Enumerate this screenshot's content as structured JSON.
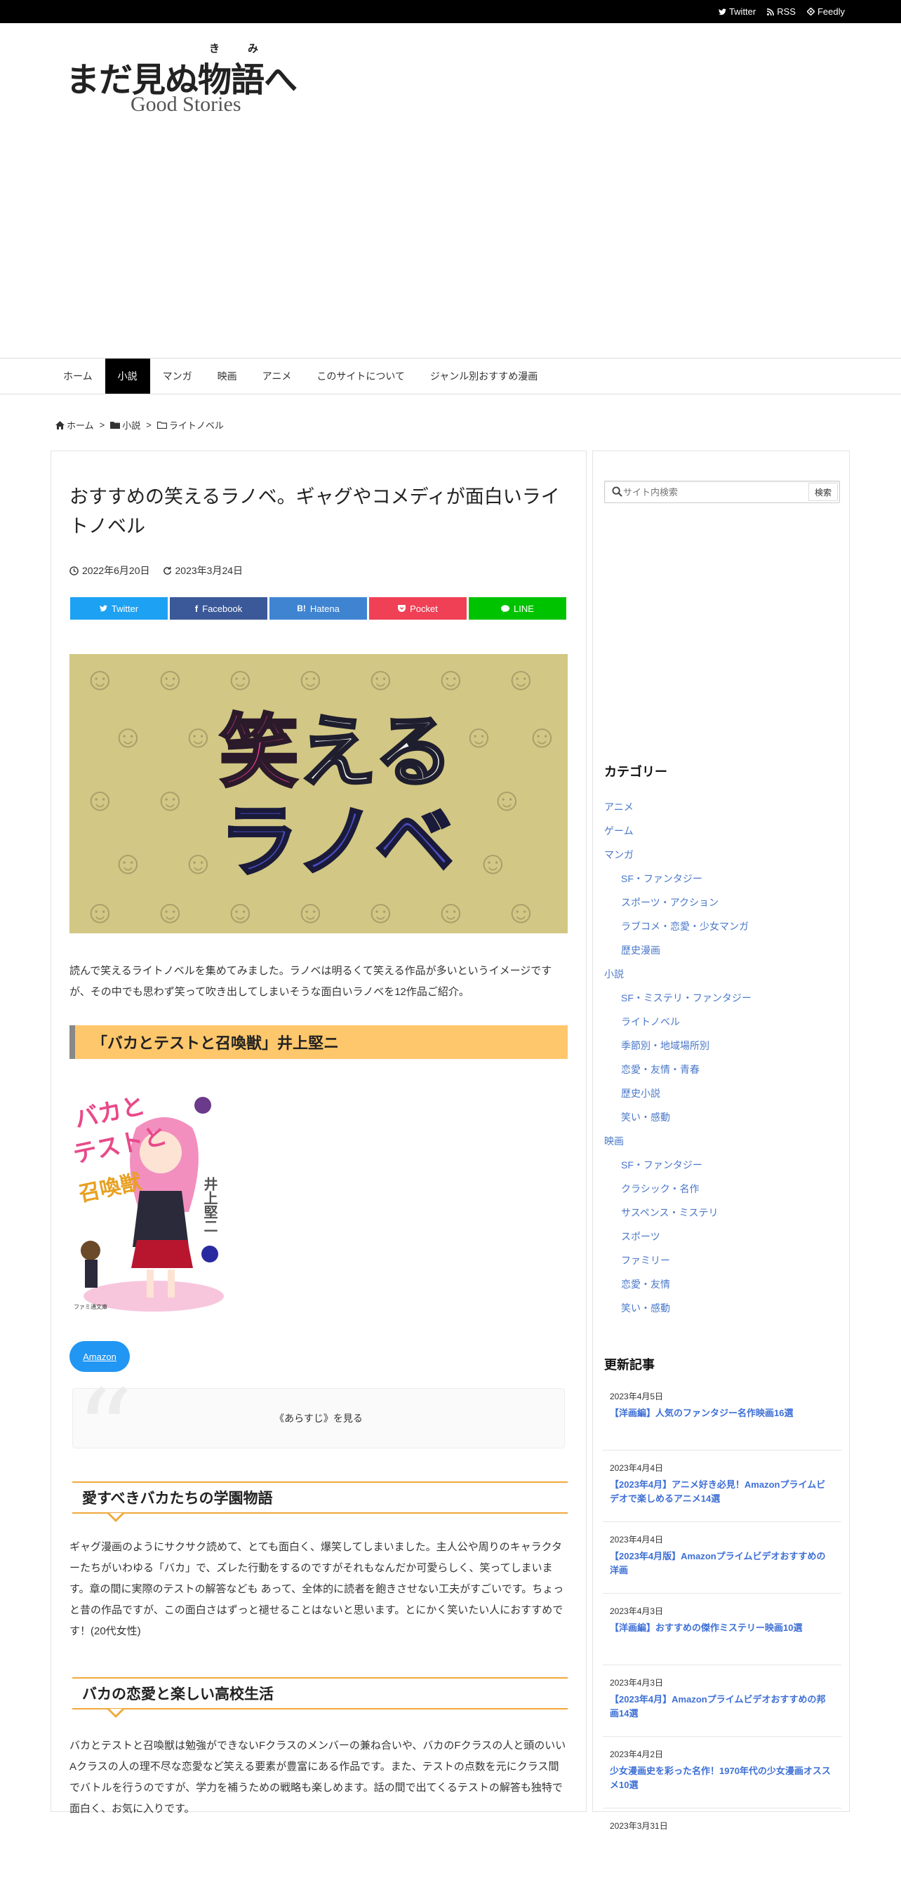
{
  "topbar": {
    "twitter": "Twitter",
    "rss": "RSS",
    "feedly": "Feedly"
  },
  "logo": {
    "ruby": "きみ",
    "main": "まだ見ぬ物語へ",
    "sub": "Good Stories"
  },
  "nav": [
    "ホーム",
    "小説",
    "マンガ",
    "映画",
    "アニメ",
    "このサイトについて",
    "ジャンル別おすすめ漫画"
  ],
  "breadcrumb": [
    "ホーム",
    "小説",
    "ライトノベル"
  ],
  "article": {
    "title": "おすすめの笑えるラノベ。ギャグやコメディが面白いライトノベル",
    "published": "2022年6月20日",
    "updated": "2023年3月24日",
    "share": [
      {
        "label": "Twitter",
        "color": "#1da1f2"
      },
      {
        "label": "Facebook",
        "color": "#3b5998"
      },
      {
        "label": "Hatena",
        "color": "#3f84d1"
      },
      {
        "label": "Pocket",
        "color": "#ef4056"
      },
      {
        "label": "LINE",
        "color": "#00c300"
      }
    ],
    "hero": {
      "line1_a": "笑",
      "line1_b": "える",
      "line2": "ラノベ"
    },
    "intro": "読んで笑えるライトノベルを集めてみました。ラノベは明るくて笑える作品が多いというイメージですが、その中でも思わず笑って吹き出してしまいそうな面白いラノベを12作品ご紹介。",
    "h2": "「バカとテストと召喚獣」井上堅ニ",
    "book": {
      "title_a": "バカと",
      "title_b": "テストと",
      "title_c": "召喚獣",
      "author": "井上堅二",
      "imprint": "ファミ通文庫"
    },
    "amazon": "Amazon",
    "spoiler": "《あらすじ》を見る",
    "h3a": "愛すべきバカたちの学園物語",
    "para1": "ギャグ漫画のようにサクサク読めて、とても面白く、爆笑してしまいました。主人公や周りのキャラクターたちがいわゆる「バカ」で、ズレた行動をするのですがそれもなんだか可愛らしく、笑ってしまいます。章の間に実際のテストの解答なども あって、全体的に読者を飽きさせない工夫がすごいです。ちょっと昔の作品ですが、この面白さはずっと褪せることはないと思います。とにかく笑いたい人におすすめです！(20代女性)",
    "h3b": "バカの恋愛と楽しい高校生活",
    "para2": "バカとテストと召喚獣は勉強ができないFクラスのメンバーの兼ね合いや、バカのFクラスの人と頭のいいAクラスの人の理不尽な恋愛など笑える要素が豊富にある作品です。また、テストの点数を元にクラス間でバトルを行うのですが、学力を補うための戦略も楽しめます。話の間で出てくるテストの解答も独特で面白く、お気に入りです。"
  },
  "sidebar": {
    "search_placeholder": "サイト内検索",
    "search_button": "検索",
    "categories_heading": "カテゴリー",
    "categories": [
      {
        "label": "アニメ",
        "child": false
      },
      {
        "label": "ゲーム",
        "child": false
      },
      {
        "label": "マンガ",
        "child": false
      },
      {
        "label": "SF・ファンタジー",
        "child": true
      },
      {
        "label": "スポーツ・アクション",
        "child": true
      },
      {
        "label": "ラブコメ・恋愛・少女マンガ",
        "child": true
      },
      {
        "label": "歴史漫画",
        "child": true
      },
      {
        "label": "小説",
        "child": false
      },
      {
        "label": "SF・ミステリ・ファンタジー",
        "child": true
      },
      {
        "label": "ライトノベル",
        "child": true
      },
      {
        "label": "季節別・地域場所別",
        "child": true
      },
      {
        "label": "恋愛・友情・青春",
        "child": true
      },
      {
        "label": "歴史小説",
        "child": true
      },
      {
        "label": "笑い・感動",
        "child": true
      },
      {
        "label": "映画",
        "child": false
      },
      {
        "label": "SF・ファンタジー",
        "child": true
      },
      {
        "label": "クラシック・名作",
        "child": true
      },
      {
        "label": "サスペンス・ミステリ",
        "child": true
      },
      {
        "label": "スポーツ",
        "child": true
      },
      {
        "label": "ファミリー",
        "child": true
      },
      {
        "label": "恋愛・友情",
        "child": true
      },
      {
        "label": "笑い・感動",
        "child": true
      }
    ],
    "recent_heading": "更新記事",
    "recent": [
      {
        "date": "2023年4月5日",
        "title": "【洋画編】人気のファンタジー名作映画16選"
      },
      {
        "date": "2023年4月4日",
        "title": "【2023年4月】アニメ好き必見！Amazonプライムビデオで楽しめるアニメ14選"
      },
      {
        "date": "2023年4月4日",
        "title": "【2023年4月版】Amazonプライムビデオおすすめの洋画"
      },
      {
        "date": "2023年4月3日",
        "title": "【洋画編】おすすめの傑作ミステリー映画10選"
      },
      {
        "date": "2023年4月3日",
        "title": "【2023年4月】Amazonプライムビデオおすすめの邦画14選"
      },
      {
        "date": "2023年4月2日",
        "title": "少女漫画史を彩った名作！1970年代の少女漫画オススメ10選"
      },
      {
        "date": "2023年3月31日",
        "title": ""
      }
    ]
  }
}
